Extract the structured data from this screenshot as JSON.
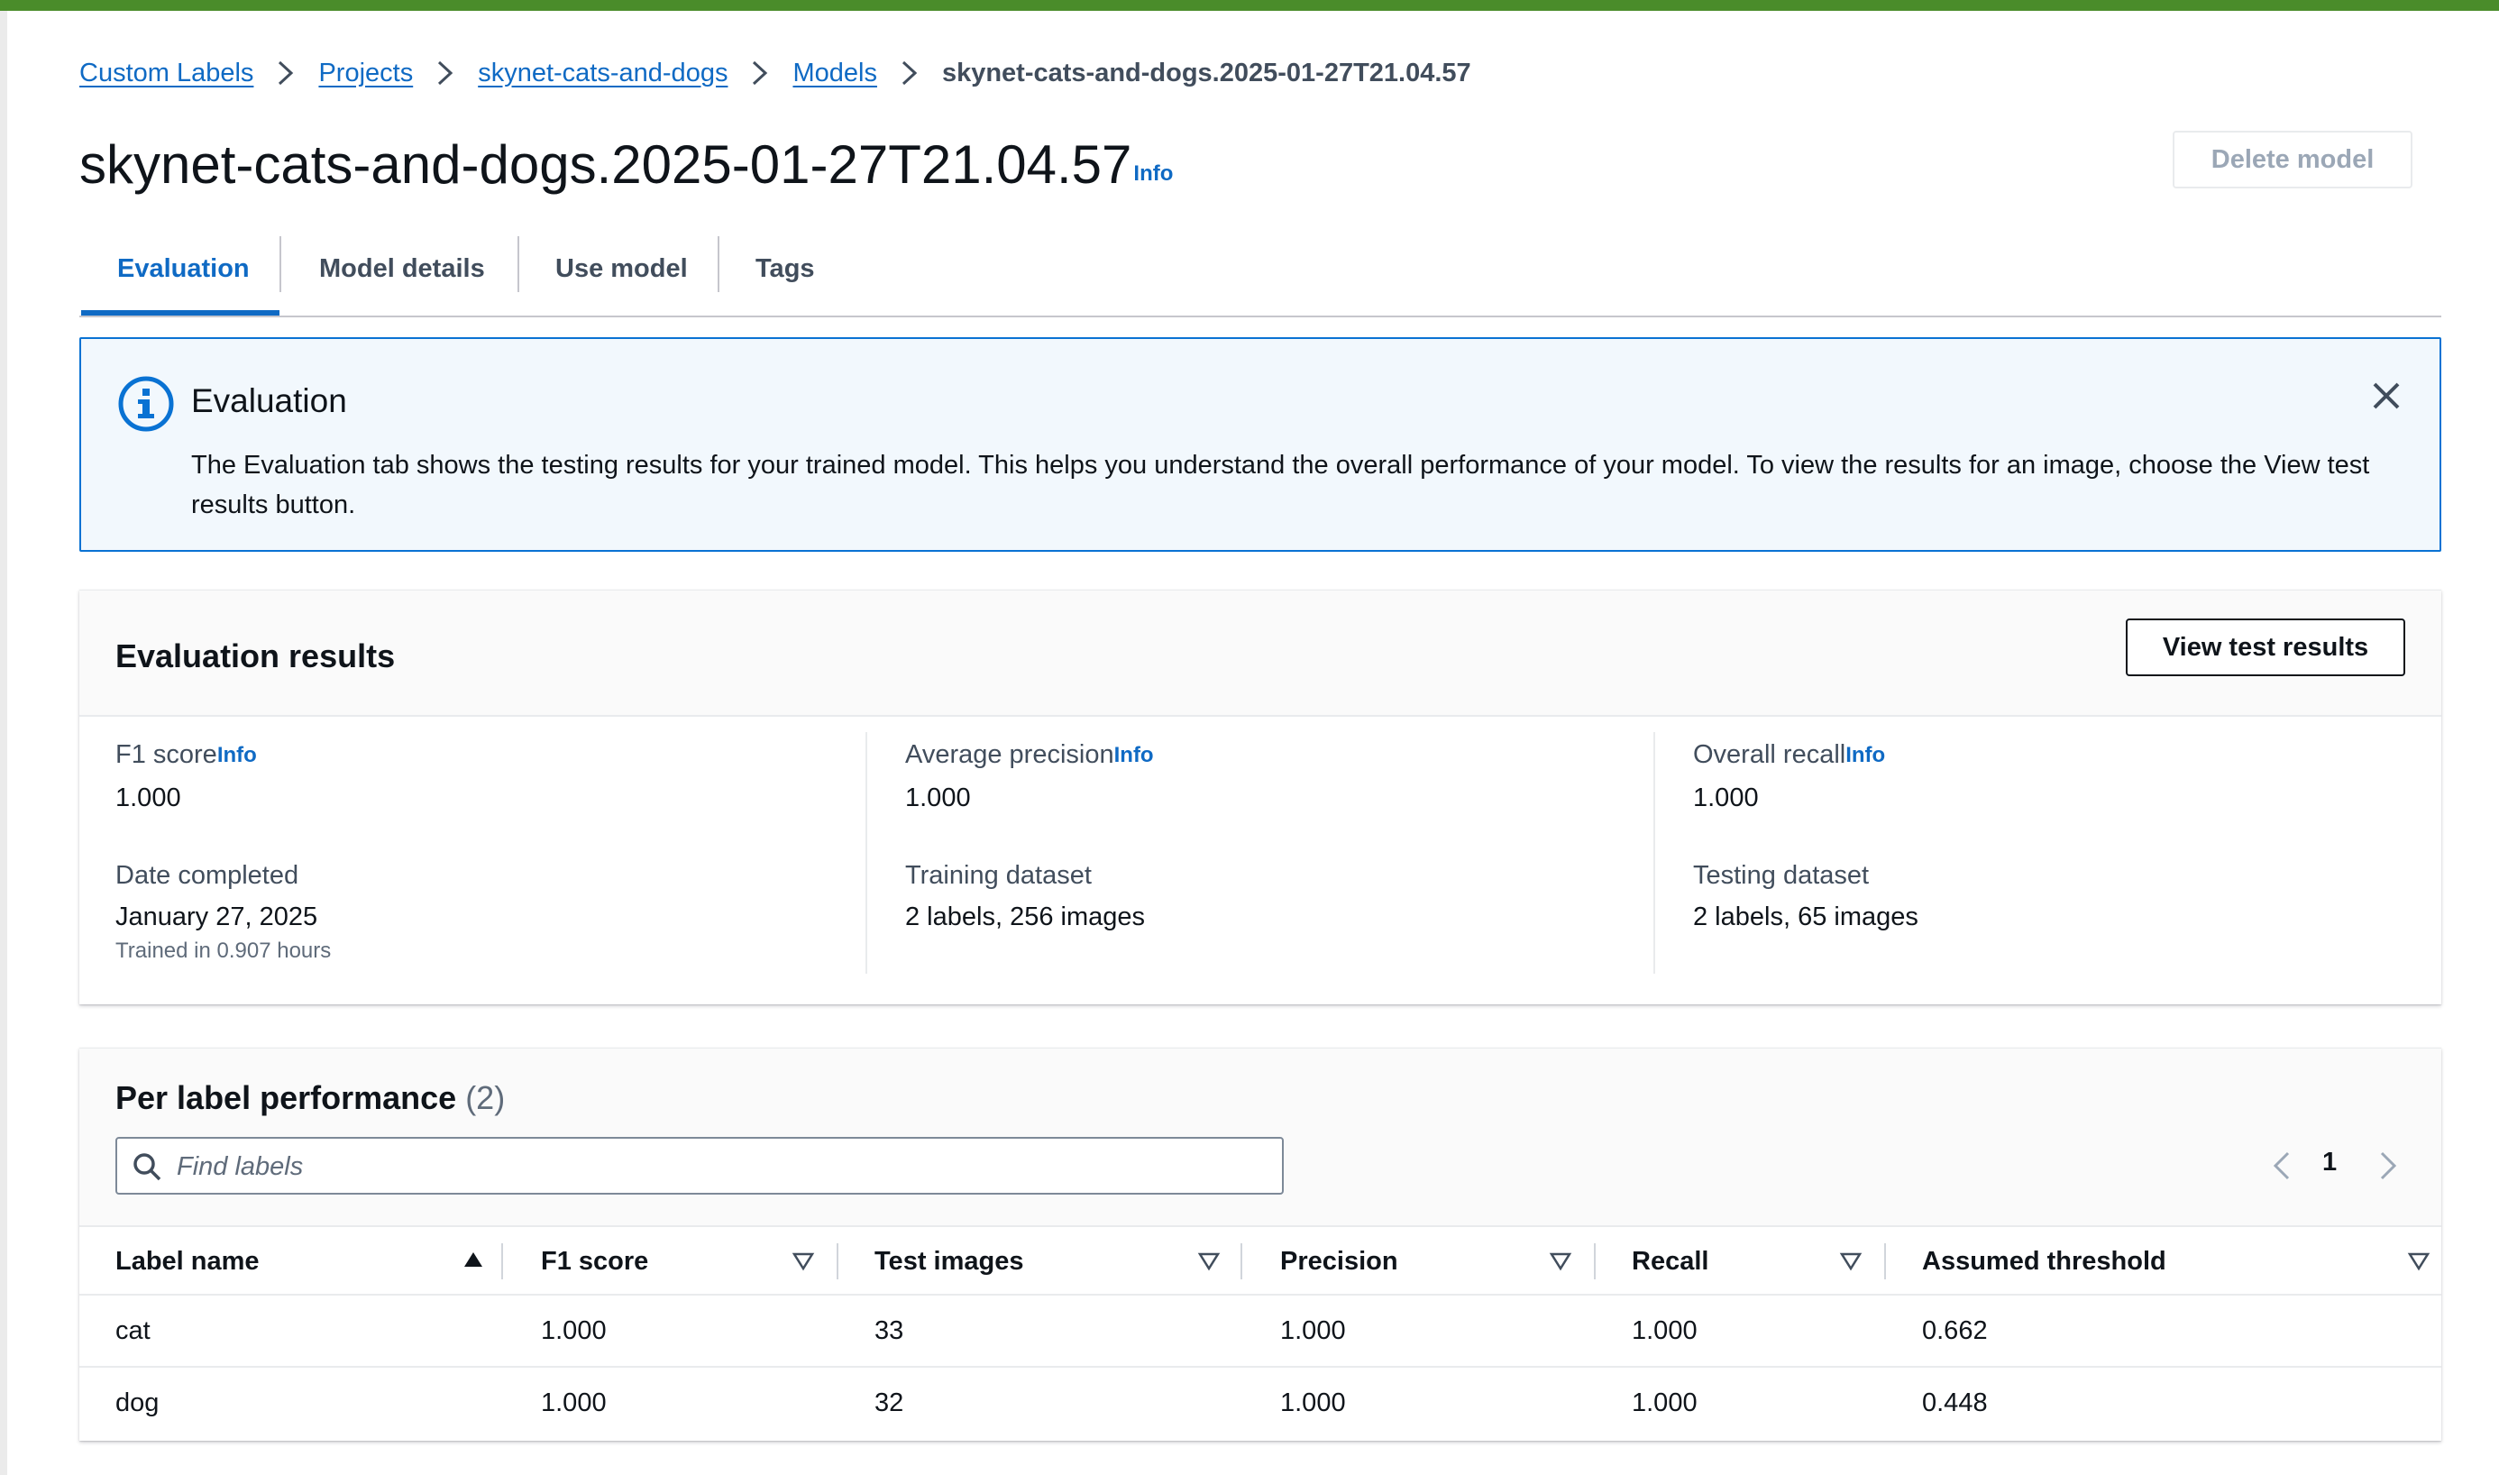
{
  "breadcrumb": {
    "items": [
      "Custom Labels",
      "Projects",
      "skynet-cats-and-dogs",
      "Models"
    ],
    "current": "skynet-cats-and-dogs.2025-01-27T21.04.57"
  },
  "header": {
    "title": "skynet-cats-and-dogs.2025-01-27T21.04.57",
    "info": "Info",
    "delete_label": "Delete model"
  },
  "tabs": [
    "Evaluation",
    "Model details",
    "Use model",
    "Tags"
  ],
  "alert": {
    "title": "Evaluation",
    "text": "The Evaluation tab shows the testing results for your trained model. This helps you understand the overall performance of your model. To view the results for an image, choose the View test results button."
  },
  "evaluation": {
    "title": "Evaluation results",
    "view_button": "View test results",
    "info": "Info",
    "f1_label": "F1 score",
    "f1_value": "1.000",
    "avg_precision_label": "Average precision",
    "avg_precision_value": "1.000",
    "recall_label": "Overall recall",
    "recall_value": "1.000",
    "date_label": "Date completed",
    "date_value": "January 27, 2025",
    "trained_in": "Trained in 0.907 hours",
    "training_label": "Training dataset",
    "training_value": "2 labels, 256 images",
    "testing_label": "Testing dataset",
    "testing_value": "2 labels, 65 images"
  },
  "per_label": {
    "title": "Per label performance",
    "count": "(2)",
    "search_placeholder": "Find labels",
    "page": "1",
    "columns": [
      "Label name",
      "F1 score",
      "Test images",
      "Precision",
      "Recall",
      "Assumed threshold"
    ],
    "rows": [
      [
        "cat",
        "1.000",
        "33",
        "1.000",
        "1.000",
        "0.662"
      ],
      [
        "dog",
        "1.000",
        "32",
        "1.000",
        "1.000",
        "0.448"
      ]
    ]
  },
  "colors": {
    "top_bar": "#4a8c2a",
    "link": "#0f6ac4",
    "alert_border": "#0972d3",
    "alert_bg": "#f2f8fd"
  }
}
